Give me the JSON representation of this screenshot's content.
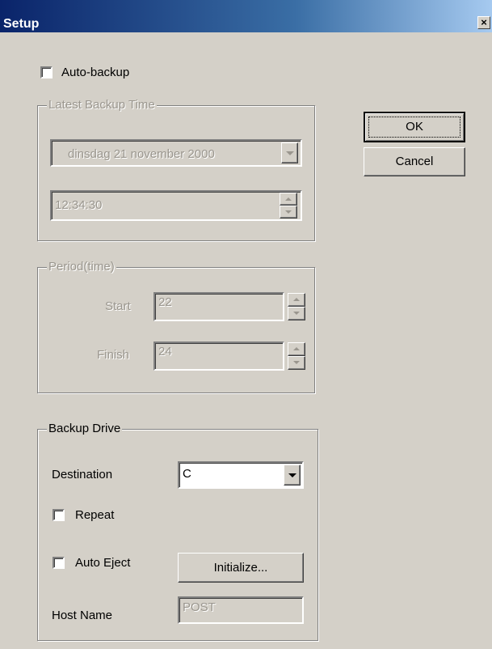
{
  "window": {
    "title": "Setup",
    "close_glyph": "×"
  },
  "auto_backup": {
    "label": "Auto-backup",
    "checked": false
  },
  "latest_backup": {
    "legend": "Latest Backup Time",
    "date_value": "dinsdag   21 november 2000",
    "time_value": "12:34:30",
    "enabled": false
  },
  "period": {
    "legend": "Period(time)",
    "start_label": "Start",
    "start_value": "22",
    "finish_label": "Finish",
    "finish_value": "24",
    "enabled": false
  },
  "backup_drive": {
    "legend": "Backup Drive",
    "destination_label": "Destination",
    "destination_value": "C",
    "repeat_label": "Repeat",
    "repeat_checked": false,
    "auto_eject_label": "Auto Eject",
    "auto_eject_checked": false,
    "initialize_label": "Initialize...",
    "host_name_label": "Host Name",
    "host_name_value": "POST"
  },
  "buttons": {
    "ok": "OK",
    "cancel": "Cancel"
  },
  "colors": {
    "titlebar_start": "#0a246a",
    "titlebar_end": "#a6caf0",
    "face": "#d4d0c8"
  }
}
